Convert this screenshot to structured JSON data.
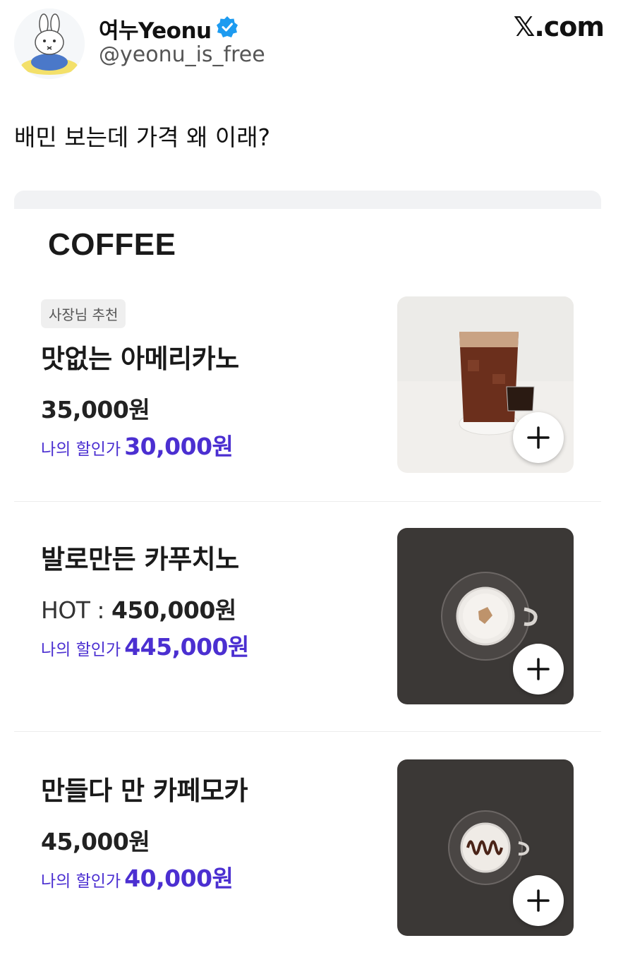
{
  "tweet": {
    "display_name": "여누Yeonu",
    "handle": "@yeonu_is_free",
    "brand": "𝕏.com",
    "text": "배민 보는데 가격 왜 이래?"
  },
  "menu": {
    "section_title": "COFFEE",
    "items": [
      {
        "badge": "사장님 추천",
        "name": "맛없는 아메리카노",
        "price_label": "",
        "price": "35,000원",
        "discount_label": "나의 할인가",
        "discount_price": "30,000원",
        "image_icon": "iced-americano-image",
        "add_icon": "plus-icon"
      },
      {
        "badge": "",
        "name": "발로만든 카푸치노",
        "price_label": "HOT : ",
        "price": "450,000원",
        "discount_label": "나의 할인가",
        "discount_price": "445,000원",
        "image_icon": "cappuccino-image",
        "add_icon": "plus-icon"
      },
      {
        "badge": "",
        "name": "만들다 만 카페모카",
        "price_label": "",
        "price": "45,000원",
        "discount_label": "나의 할인가",
        "discount_price": "40,000원",
        "image_icon": "cafe-mocha-image",
        "add_icon": "plus-icon"
      }
    ]
  },
  "colors": {
    "discount": "#4b2fd1",
    "verified_badge": "#1d9bf0",
    "image_dark_bg": "#3b3836"
  }
}
